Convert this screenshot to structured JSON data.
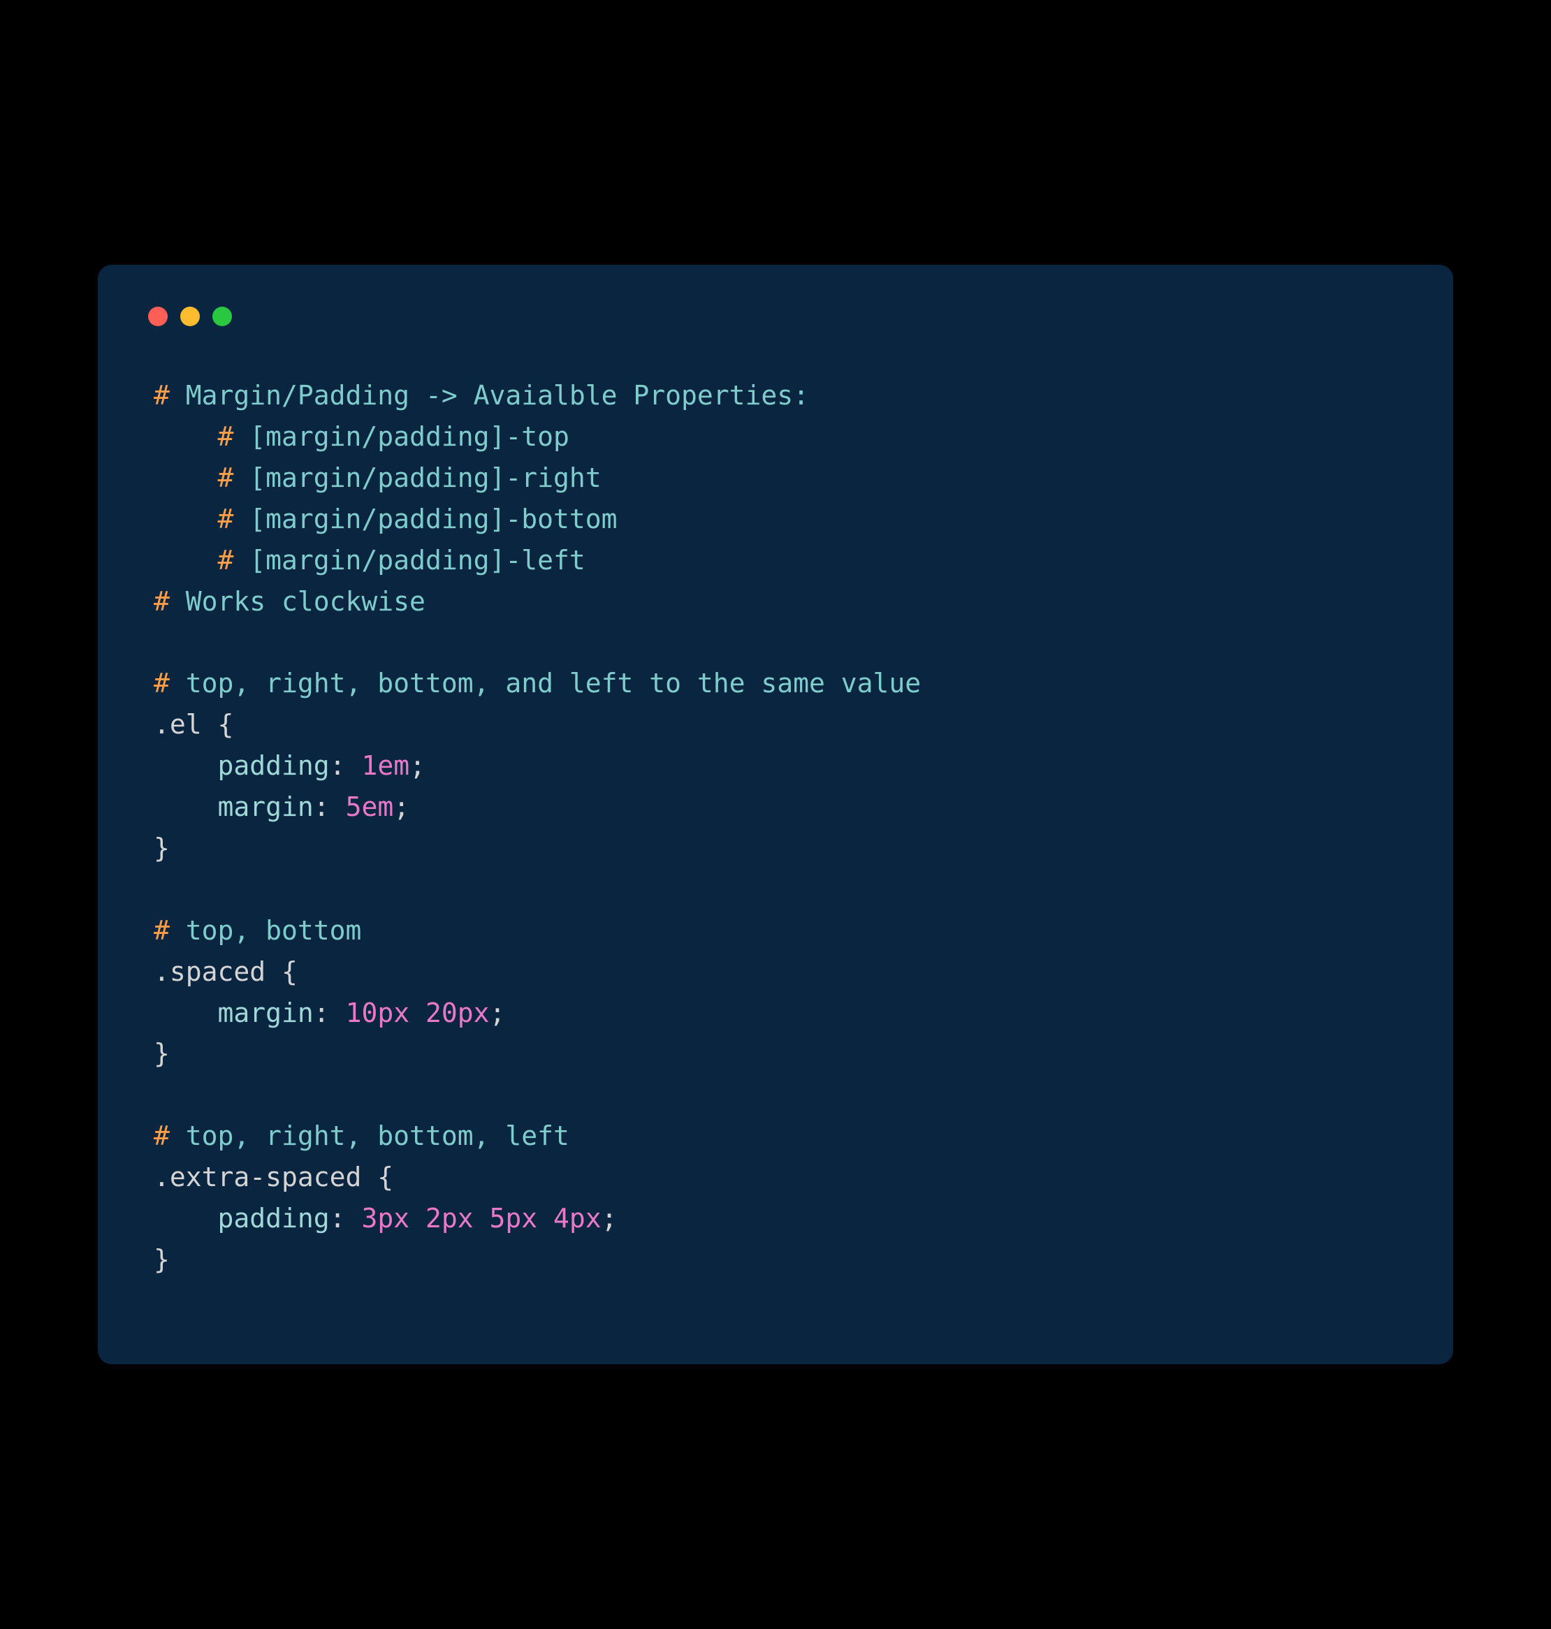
{
  "lines": {
    "l1_hash": "#",
    "l1_text": " Margin/Padding -> Avaialble Properties:",
    "l2_hash": "#",
    "l2_text": " [margin/padding]-top",
    "l3_hash": "#",
    "l3_text": " [margin/padding]-right",
    "l4_hash": "#",
    "l4_text": " [margin/padding]-bottom",
    "l5_hash": "#",
    "l5_text": " [margin/padding]-left",
    "l6_hash": "#",
    "l6_text": " Works clockwise",
    "l7_hash": "#",
    "l7_text": " top, right, bottom, and left to the same value",
    "sel1": ".el ",
    "brace_open": "{",
    "brace_close": "}",
    "prop_padding": "padding",
    "prop_margin": "margin",
    "colon": ": ",
    "semi": ";",
    "val_1em": "1em",
    "val_5em": "5em",
    "l11_hash": "#",
    "l11_text": " top, bottom",
    "sel2": ".spaced ",
    "val_10_20": "10px 20px",
    "l15_hash": "#",
    "l15_text": " top, right, bottom, left",
    "sel3": ".extra-spaced ",
    "val_3_2_5_4": "3px 2px 5px 4px",
    "indent1": "    ",
    "indent2": "    "
  }
}
